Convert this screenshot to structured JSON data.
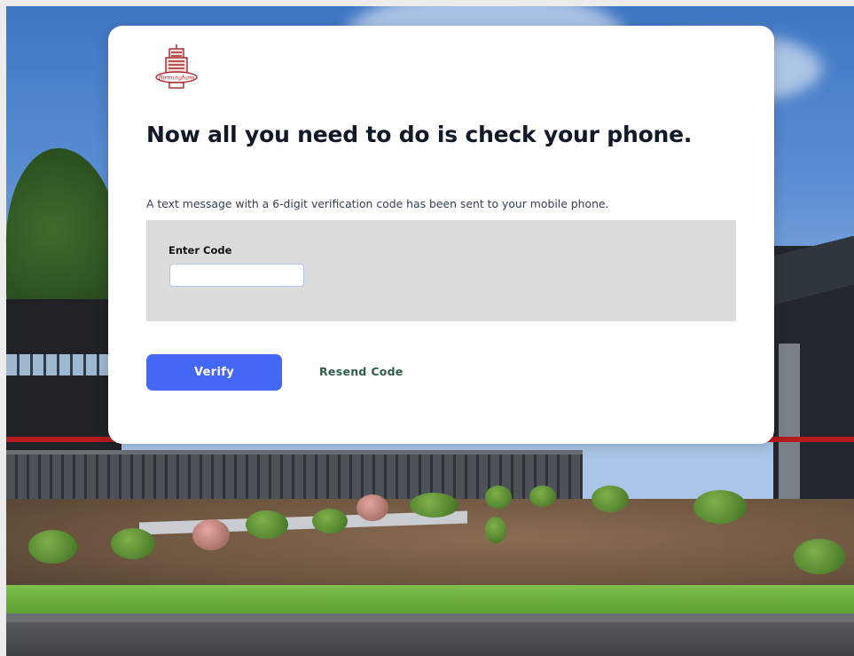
{
  "brand": {
    "logo_icon": "building-seal-icon",
    "logo_text": "Birmingham",
    "accent_color": "#a3262a"
  },
  "page": {
    "title": "Now all you need to do is check your phone.",
    "subtitle": "A text message with a 6-digit verification code has been sent to your mobile phone."
  },
  "form": {
    "code_label": "Enter Code",
    "code_value": "",
    "code_placeholder": ""
  },
  "actions": {
    "verify_label": "Verify",
    "resend_label": "Resend Code",
    "primary_color": "#4567f5",
    "link_color": "#2f5d46"
  }
}
